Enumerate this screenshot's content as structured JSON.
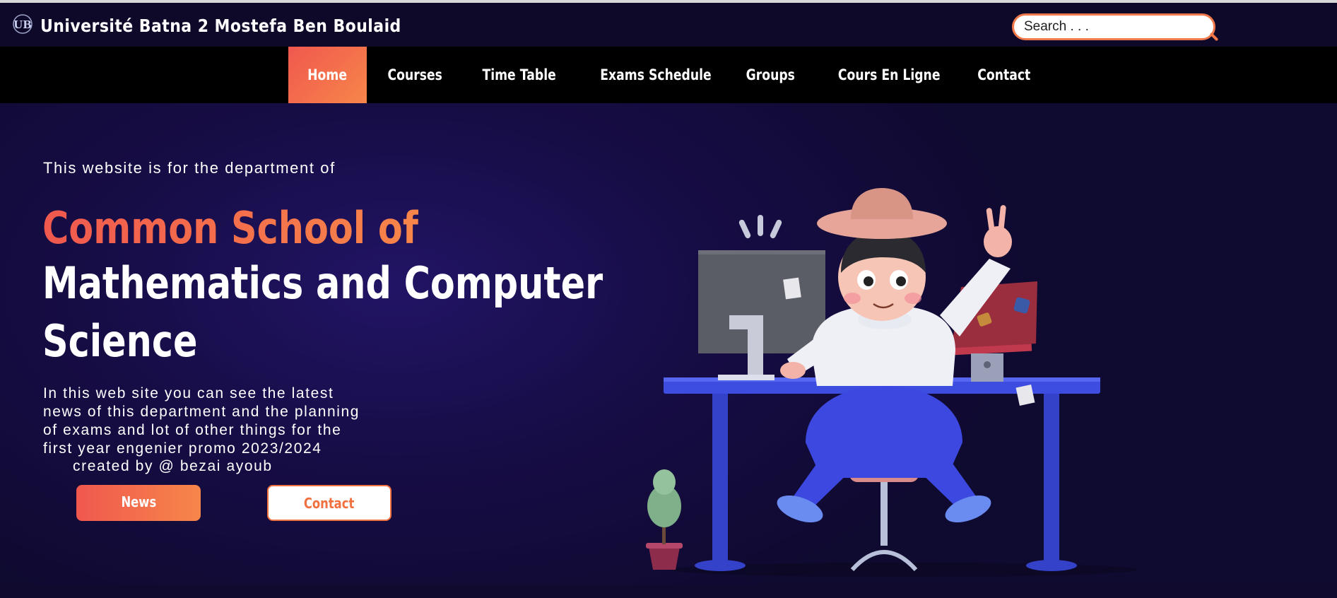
{
  "header": {
    "logo_text": "UB",
    "site_title": "Université Batna 2 Mostefa Ben Boulaid",
    "search": {
      "placeholder": "Search . . ."
    }
  },
  "nav": {
    "items": [
      {
        "label": "Home",
        "active": true
      },
      {
        "label": "Courses"
      },
      {
        "label": "Time Table"
      },
      {
        "label": "Exams Schedule"
      },
      {
        "label": "Groups"
      },
      {
        "label": "Cours En Ligne"
      },
      {
        "label": "Contact"
      }
    ]
  },
  "hero": {
    "intro": "This website is for the department of",
    "headline_line1": "Common School of",
    "headline_line2": "Mathematics and Computer",
    "headline_line3": "Science",
    "description_lines": [
      "In this web site you can see the latest",
      "news of this department and the planning",
      "of exams and lot of other things for the",
      "first year engenier promo 2023/2024"
    ],
    "credit": "created by @ bezai ayoub",
    "buttons": {
      "news_label": "News",
      "contact_label": "Contact"
    }
  },
  "colors": {
    "accent_start": "#f0584e",
    "accent_end": "#f7864a",
    "background": "#0f0a2e",
    "nav_background": "#000000"
  }
}
